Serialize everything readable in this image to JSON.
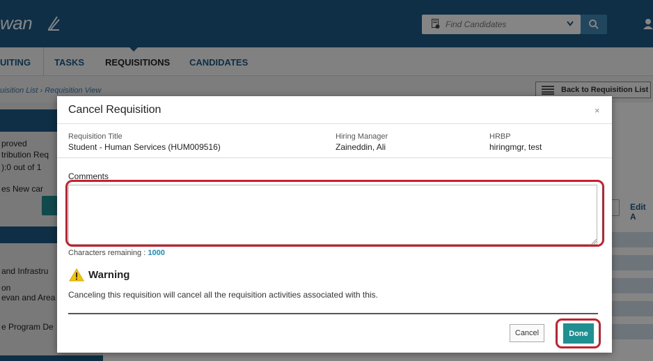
{
  "app": {
    "logo_text": "wan",
    "search_placeholder": "Find Candidates"
  },
  "nav": {
    "items": [
      {
        "label": "UITING"
      },
      {
        "label": "TASKS"
      },
      {
        "label": "REQUISITIONS",
        "active": true
      },
      {
        "label": "CANDIDATES"
      }
    ]
  },
  "breadcrumb": "uisition List › Requisition View",
  "back_button_label": "Back to Requisition List",
  "left_panel": {
    "lines": [
      "proved",
      "tribution Req",
      "):0 out of 1",
      "es    New car",
      "and Infrastru",
      "on",
      "evan and Area",
      "e Program De"
    ]
  },
  "right_edge": {
    "edit_label": "Edit A"
  },
  "modal": {
    "title": "Cancel Requisition",
    "close_symbol": "×",
    "requisition_title_label": "Requisition Title",
    "requisition_title_value": "Student - Human Services (HUM009516)",
    "hiring_manager_label": "Hiring Manager",
    "hiring_manager_value": "Zaineddin, Ali",
    "hrbp_label": "HRBP",
    "hrbp_value": "hiringmgr, test",
    "comments_label": "Comments",
    "comments_value": "",
    "chars_remaining_label": "Characters remaining :",
    "chars_remaining_value": "1000",
    "warning_title": "Warning",
    "warning_message": "Canceling this requisition will cancel all the requisition activities associated with this.",
    "cancel_label": "Cancel",
    "done_label": "Done"
  },
  "colors": {
    "brand_blue": "#1c5b84",
    "teal": "#1f8f92",
    "highlight_red": "#c4202e",
    "warning_yellow": "#f5c400"
  },
  "icons": [
    "leaf-logo-icon",
    "document-search-icon",
    "chevron-down-icon",
    "search-icon",
    "user-icon",
    "list-icon",
    "close-icon",
    "resize-grip-icon",
    "warning-icon"
  ]
}
